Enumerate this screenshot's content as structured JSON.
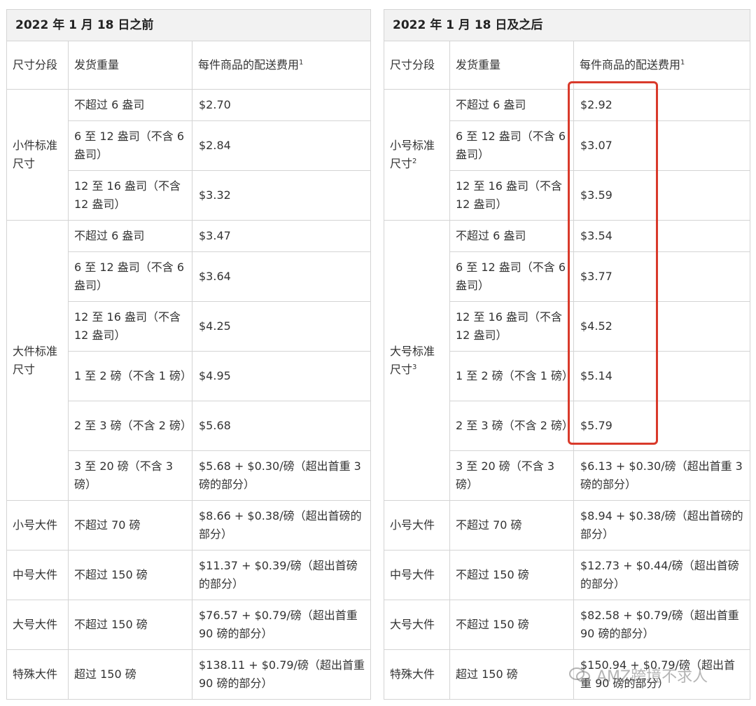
{
  "left": {
    "title": "2022 年 1 月 18 日之前",
    "headers": {
      "segment": "尺寸分段",
      "weight": "发货重量",
      "fee": "每件商品的配送费用",
      "fee_sup": "1"
    },
    "small_standard": {
      "segment": "小件标准尺寸",
      "segment_sup": "",
      "rows": [
        {
          "weight": "不超过 6 盎司",
          "fee": "$2.70"
        },
        {
          "weight": "6 至 12 盎司（不含 6 盎司）",
          "fee": "$2.84"
        },
        {
          "weight": "12 至 16 盎司（不含 12 盎司）",
          "fee": "$3.32"
        }
      ]
    },
    "large_standard": {
      "segment": "大件标准尺寸",
      "segment_sup": "",
      "rows": [
        {
          "weight": "不超过 6 盎司",
          "fee": "$3.47"
        },
        {
          "weight": "6 至 12 盎司（不含 6 盎司）",
          "fee": "$3.64"
        },
        {
          "weight": "12 至 16 盎司（不含 12 盎司）",
          "fee": "$4.25"
        },
        {
          "weight": "1 至 2 磅（不含 1 磅）",
          "fee": "$4.95"
        },
        {
          "weight": "2 至 3 磅（不含 2 磅）",
          "fee": "$5.68"
        },
        {
          "weight": "3 至 20 磅（不含 3 磅）",
          "fee": "$5.68 + $0.30/磅（超出首重 3 磅的部分）"
        }
      ]
    },
    "oversize": [
      {
        "segment": "小号大件",
        "weight": "不超过 70 磅",
        "fee": "$8.66 + $0.38/磅（超出首磅的部分）"
      },
      {
        "segment": "中号大件",
        "weight": "不超过 150 磅",
        "fee": "$11.37 + $0.39/磅（超出首磅的部分）"
      },
      {
        "segment": "大号大件",
        "weight": "不超过 150 磅",
        "fee": "$76.57 + $0.79/磅（超出首重 90 磅的部分）"
      },
      {
        "segment": "特殊大件",
        "weight": "超过 150 磅",
        "fee": "$138.11 + $0.79/磅（超出首重 90 磅的部分）"
      }
    ]
  },
  "right": {
    "title": "2022 年 1 月 18 日及之后",
    "headers": {
      "segment": "尺寸分段",
      "weight": "发货重量",
      "fee": "每件商品的配送费用",
      "fee_sup": "1"
    },
    "small_standard": {
      "segment": "小号标准尺寸",
      "segment_sup": "2",
      "rows": [
        {
          "weight": "不超过 6 盎司",
          "fee": "$2.92"
        },
        {
          "weight": "6 至 12 盎司（不含 6 盎司）",
          "fee": "$3.07"
        },
        {
          "weight": "12 至 16 盎司（不含 12 盎司）",
          "fee": "$3.59"
        }
      ]
    },
    "large_standard": {
      "segment": "大号标准尺寸",
      "segment_sup": "3",
      "rows": [
        {
          "weight": "不超过 6 盎司",
          "fee": "$3.54"
        },
        {
          "weight": "6 至 12 盎司（不含 6 盎司）",
          "fee": "$3.77"
        },
        {
          "weight": "12 至 16 盎司（不含 12 盎司）",
          "fee": "$4.52"
        },
        {
          "weight": "1 至 2 磅（不含 1 磅）",
          "fee": "$5.14"
        },
        {
          "weight": "2 至 3 磅（不含 2 磅）",
          "fee": "$5.79"
        },
        {
          "weight": "3 至 20 磅（不含 3 磅）",
          "fee": "$6.13 + $0.30/磅（超出首重 3 磅的部分）"
        }
      ]
    },
    "oversize": [
      {
        "segment": "小号大件",
        "weight": "不超过 70 磅",
        "fee": "$8.94 + $0.38/磅（超出首磅的部分）"
      },
      {
        "segment": "中号大件",
        "weight": "不超过 150 磅",
        "fee": "$12.73 + $0.44/磅（超出首磅的部分）"
      },
      {
        "segment": "大号大件",
        "weight": "不超过 150 磅",
        "fee": "$82.58 + $0.79/磅（超出首重 90 磅的部分）"
      },
      {
        "segment": "特殊大件",
        "weight": "超过 150 磅",
        "fee": "$150.94 + $0.79/磅（超出首重 90 磅的部分）"
      }
    ]
  },
  "highlight_color": "#d93a2b",
  "watermark": {
    "text": "AMZ跨境不求人",
    "icon": "wechat-icon"
  }
}
